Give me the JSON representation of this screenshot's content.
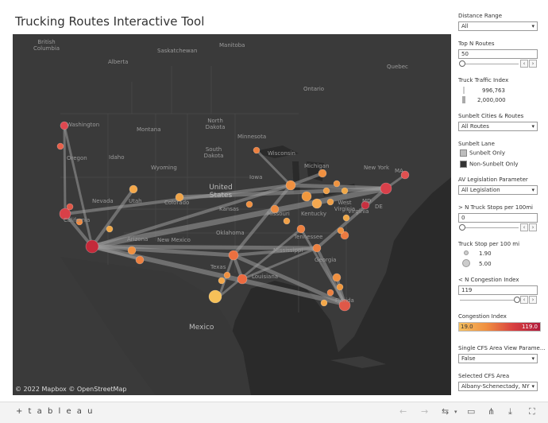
{
  "title": "Trucking Routes Interactive Tool",
  "map": {
    "attribution": "© 2022 Mapbox © OpenStreetMap",
    "place_labels": [
      {
        "text": "British\nColumbia"
      },
      {
        "text": "Saskatchewan"
      },
      {
        "text": "Manitoba"
      },
      {
        "text": "Quebec"
      },
      {
        "text": "Ontario"
      },
      {
        "text": "Alberta"
      },
      {
        "text": "Washington"
      },
      {
        "text": "Montana"
      },
      {
        "text": "North Dakota"
      },
      {
        "text": "Minnesota"
      },
      {
        "text": "Oregon"
      },
      {
        "text": "Idaho"
      },
      {
        "text": "South Dakota"
      },
      {
        "text": "Wisconsin"
      },
      {
        "text": "Michigan"
      },
      {
        "text": "New York"
      },
      {
        "text": "Wyoming"
      },
      {
        "text": "Iowa"
      },
      {
        "text": "Nevada"
      },
      {
        "text": "Utah"
      },
      {
        "text": "Colorado"
      },
      {
        "text": "United States"
      },
      {
        "text": "Kansas"
      },
      {
        "text": "Missouri"
      },
      {
        "text": "Kentucky"
      },
      {
        "text": "West Virginia"
      },
      {
        "text": "Virginia"
      },
      {
        "text": "California"
      },
      {
        "text": "Arizona"
      },
      {
        "text": "New Mexico"
      },
      {
        "text": "Oklahoma"
      },
      {
        "text": "Tennessee"
      },
      {
        "text": "Mississippi"
      },
      {
        "text": "Georgia"
      },
      {
        "text": "Texas"
      },
      {
        "text": "Louisiana"
      },
      {
        "text": "Florida"
      },
      {
        "text": "Mexico"
      },
      {
        "text": "MD"
      },
      {
        "text": "DE"
      },
      {
        "text": "MA"
      }
    ]
  },
  "controls": {
    "distance_range": {
      "label": "Distance Range",
      "value": "All"
    },
    "top_n_routes": {
      "label": "Top N Routes",
      "value": "50"
    },
    "truck_traffic_index": {
      "label": "Truck Traffic Index",
      "values": [
        "996,763",
        "2,000,000"
      ]
    },
    "sunbelt_cities": {
      "label": "Sunbelt Cities & Routes",
      "value": "All Routes"
    },
    "sunbelt_lane": {
      "label": "Sunbelt Lane",
      "items": [
        {
          "label": "Sunbelt Only",
          "color": "#bdbdbd"
        },
        {
          "label": "Non-Sunbelt Only",
          "color": "#333333"
        }
      ]
    },
    "av_legislation": {
      "label": "AV Legislation Parameter",
      "value": "All Legislation"
    },
    "n_truck_stops": {
      "label": "> N Truck Stops per 100mi",
      "value": "0"
    },
    "truck_stop_per_100": {
      "label": "Truck Stop per 100 mi",
      "values": [
        "1.90",
        "5.00"
      ]
    },
    "n_congestion": {
      "label": "< N Congestion Index",
      "value": "119"
    },
    "congestion_index": {
      "label": "Congestion Index",
      "min": "19.0",
      "max": "119.0"
    },
    "single_cfs": {
      "label": "Single CFS Area View Parame...",
      "value": "False"
    },
    "selected_cfs": {
      "label": "Selected CFS Area",
      "value": "Albany-Schenectady, NY"
    }
  },
  "footer": {
    "brand": "+ t a b l e a u"
  },
  "colors": {
    "map_bg": "#2a2a2a",
    "route": "#9a9a9a",
    "node_low": "#f5c060",
    "node_high": "#b01c3c"
  }
}
